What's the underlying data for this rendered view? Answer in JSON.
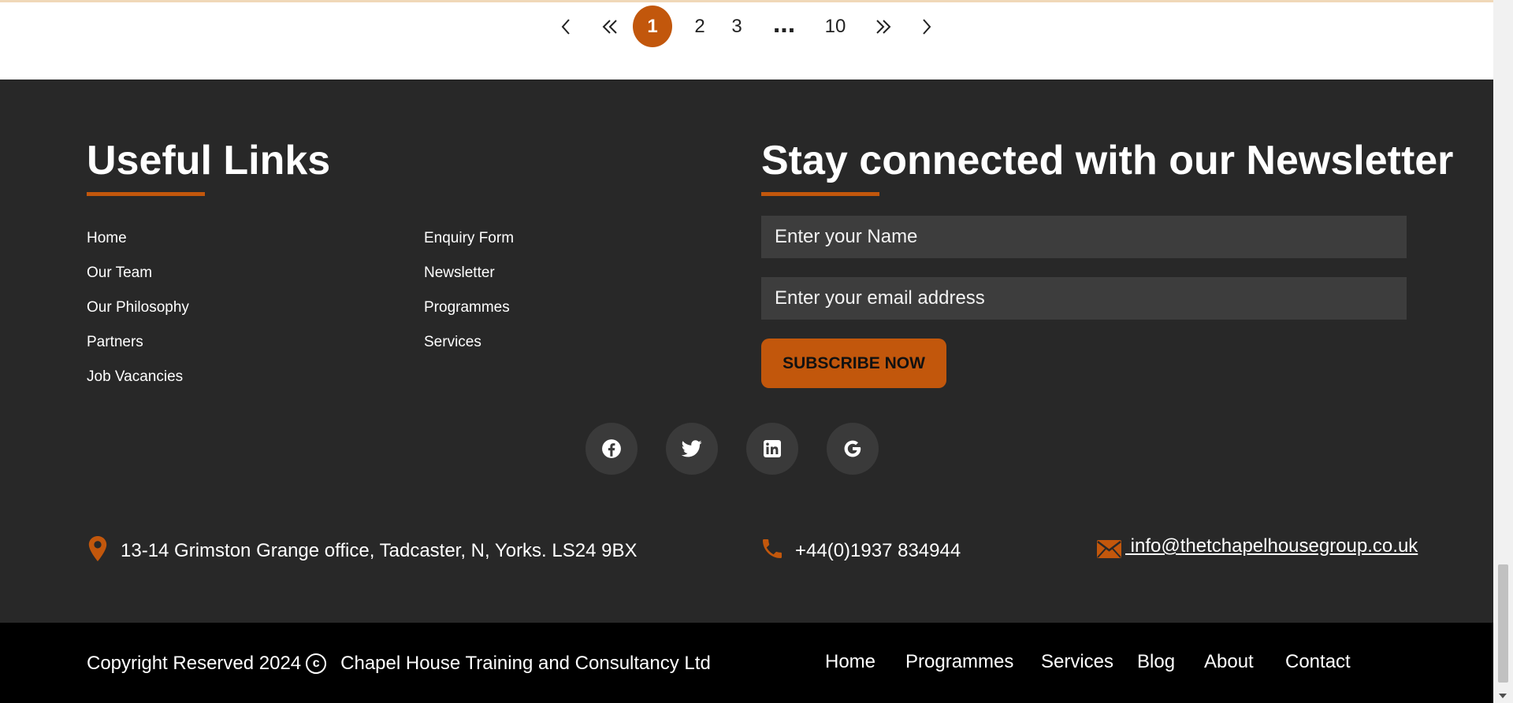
{
  "pagination": {
    "pages": [
      "1",
      "2",
      "3",
      "10"
    ],
    "current": "1",
    "ellipsis": "...",
    "icons": [
      "chevron-left-icon",
      "double-chevron-left-icon",
      "double-chevron-right-icon",
      "chevron-right-icon"
    ]
  },
  "useful_links": {
    "title": "Useful Links",
    "col1": [
      "Home",
      "Our Team",
      "Our Philosophy",
      "Partners",
      "Job Vacancies"
    ],
    "col2": [
      "Enquiry Form",
      "Newsletter",
      "Programmes",
      "Services"
    ]
  },
  "newsletter": {
    "title": "Stay connected with our Newsletter",
    "name_placeholder": "Enter your Name",
    "email_placeholder": "Enter your email address",
    "subscribe_label": "SUBSCRIBE NOW"
  },
  "social": [
    "facebook-icon",
    "twitter-icon",
    "linkedin-icon",
    "google-icon"
  ],
  "contact": {
    "address": "13-14 Grimston Grange office, Tadcaster, N, Yorks. LS24 9BX",
    "phone": "+44(0)1937 834944",
    "email": " info@thetchapelhousegroup.co.uk"
  },
  "bottom_bar": {
    "copyright_prefix": "Copyright Reserved 2024",
    "copyright_symbol": "c",
    "company": "Chapel House Training and Consultancy Ltd",
    "nav": [
      "Home",
      "Programmes",
      "Services",
      "Blog",
      "About",
      "Contact"
    ]
  },
  "colors": {
    "accent": "#c2570c",
    "footer_bg": "#282828",
    "bottom_bg": "#000000",
    "field_bg": "#3d3d3d"
  }
}
